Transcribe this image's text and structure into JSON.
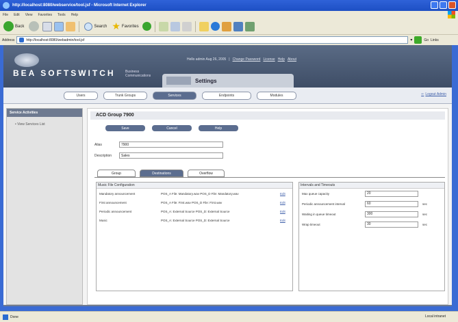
{
  "browser": {
    "title": "http://localhost:8080/webservice/tool.jsf - Microsoft Internet Explorer",
    "menu": [
      "File",
      "Edit",
      "View",
      "Favorites",
      "Tools",
      "Help"
    ],
    "toolbar": {
      "back": "Back",
      "search": "Search",
      "favorites": "Favorites"
    },
    "address_label": "Address",
    "address_value": "http://localhost:8080/webadmin/tool.jsf",
    "go_label": "Go",
    "links_label": "Links",
    "status_text": "Done",
    "zone_text": "Local intranet"
  },
  "app": {
    "logo": "BEA SOFTSWITCH",
    "logo_sub_1": "Business",
    "logo_sub_2": "Communications",
    "header_info": "Hello  admin   Aug 26, 2005",
    "header_links": [
      "Change Password",
      "License",
      "Help",
      "About"
    ],
    "settings_label": "Settings",
    "logout": "Logout Admin",
    "nav_tabs": [
      "Users",
      "Trunk Groups",
      "Services",
      "Endpoints",
      "Modules"
    ],
    "active_nav": 2
  },
  "sidebar": {
    "heading": "Service Activities",
    "items": [
      "• View Services List"
    ]
  },
  "main": {
    "group_title": "ACD Group 7900",
    "buttons": [
      "Save",
      "Cancel",
      "Help"
    ],
    "alias_label": "Alias",
    "alias_value": "7900",
    "description_label": "Description",
    "description_value": "Sales",
    "sub_tabs": [
      "Group",
      "Destinations",
      "Overflow"
    ],
    "active_sub_tab": 1,
    "music_file": {
      "heading": "Music File Configuration",
      "rows": [
        {
          "name": "Mandatory announcement",
          "value": "POS_A File: Mandatory.wav POS_D File: Mandatory.wav",
          "edit": "Edit"
        },
        {
          "name": "First announcement",
          "value": "POS_A File: First.wav POS_D File: First.wav",
          "edit": "Edit"
        },
        {
          "name": "Periodic announcement",
          "value": "POS_A: External Source POS_D: External Source",
          "edit": "Edit"
        },
        {
          "name": "Music",
          "value": "POS_A: External Source POS_D: External Source",
          "edit": "Edit"
        }
      ]
    },
    "intervals": {
      "heading": "Intervals and Timeouts",
      "rows": [
        {
          "name": "Max queue capacity",
          "value": "20",
          "unit": ""
        },
        {
          "name": "Periodic announcement interval",
          "value": "60",
          "unit": "sec"
        },
        {
          "name": "Waiting in queue timeout",
          "value": "300",
          "unit": "sec"
        },
        {
          "name": "Wrap timeout",
          "value": "30",
          "unit": "sec"
        }
      ]
    }
  },
  "colors": {
    "nav_active": "#5b6d8f",
    "header_bg": "#4a5a75",
    "xp_blue": "#2f62d8"
  }
}
